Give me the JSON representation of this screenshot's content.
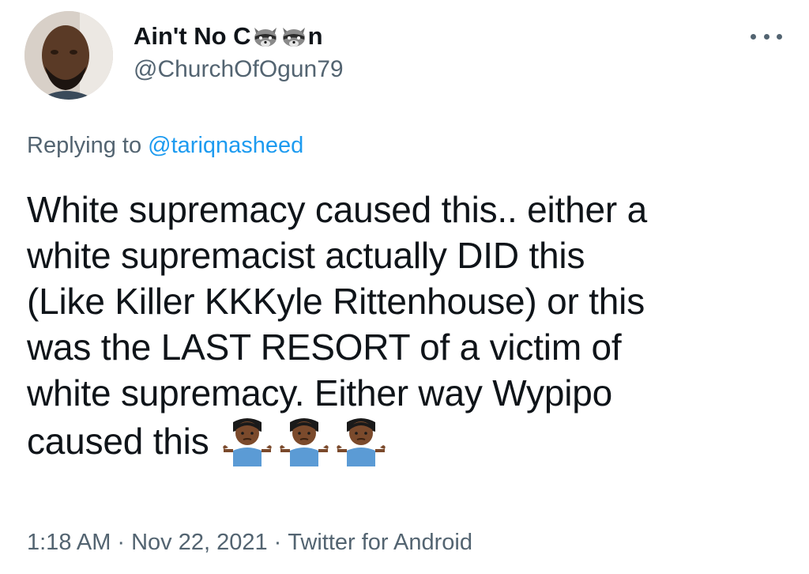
{
  "tweet": {
    "author": {
      "name_start": "Ain't No C",
      "name_end": "n",
      "name_icons": [
        "raccoon-icon",
        "raccoon-icon"
      ],
      "handle": "@ChurchOfOgun79"
    },
    "more_icon": "more-horizontal-icon",
    "reply_prefix": "Replying to",
    "reply_to": "@tariqnasheed",
    "text_lines": [
      "White supremacy caused this.. either a",
      "white supremacist actually DID this",
      "(Like Killer KKKyle Rittenhouse) or this",
      "was the LAST RESORT of a victim of",
      "white supremacy. Either way Wypipo",
      "caused this"
    ],
    "text_emoji": [
      "man-shrugging-icon",
      "man-shrugging-icon",
      "man-shrugging-icon"
    ],
    "time": "1:18 AM",
    "separator": "·",
    "date": "Nov 22, 2021",
    "source": "Twitter for Android",
    "colors": {
      "text": "#0f1419",
      "secondary": "#536471",
      "link": "#1d9bf0"
    }
  }
}
